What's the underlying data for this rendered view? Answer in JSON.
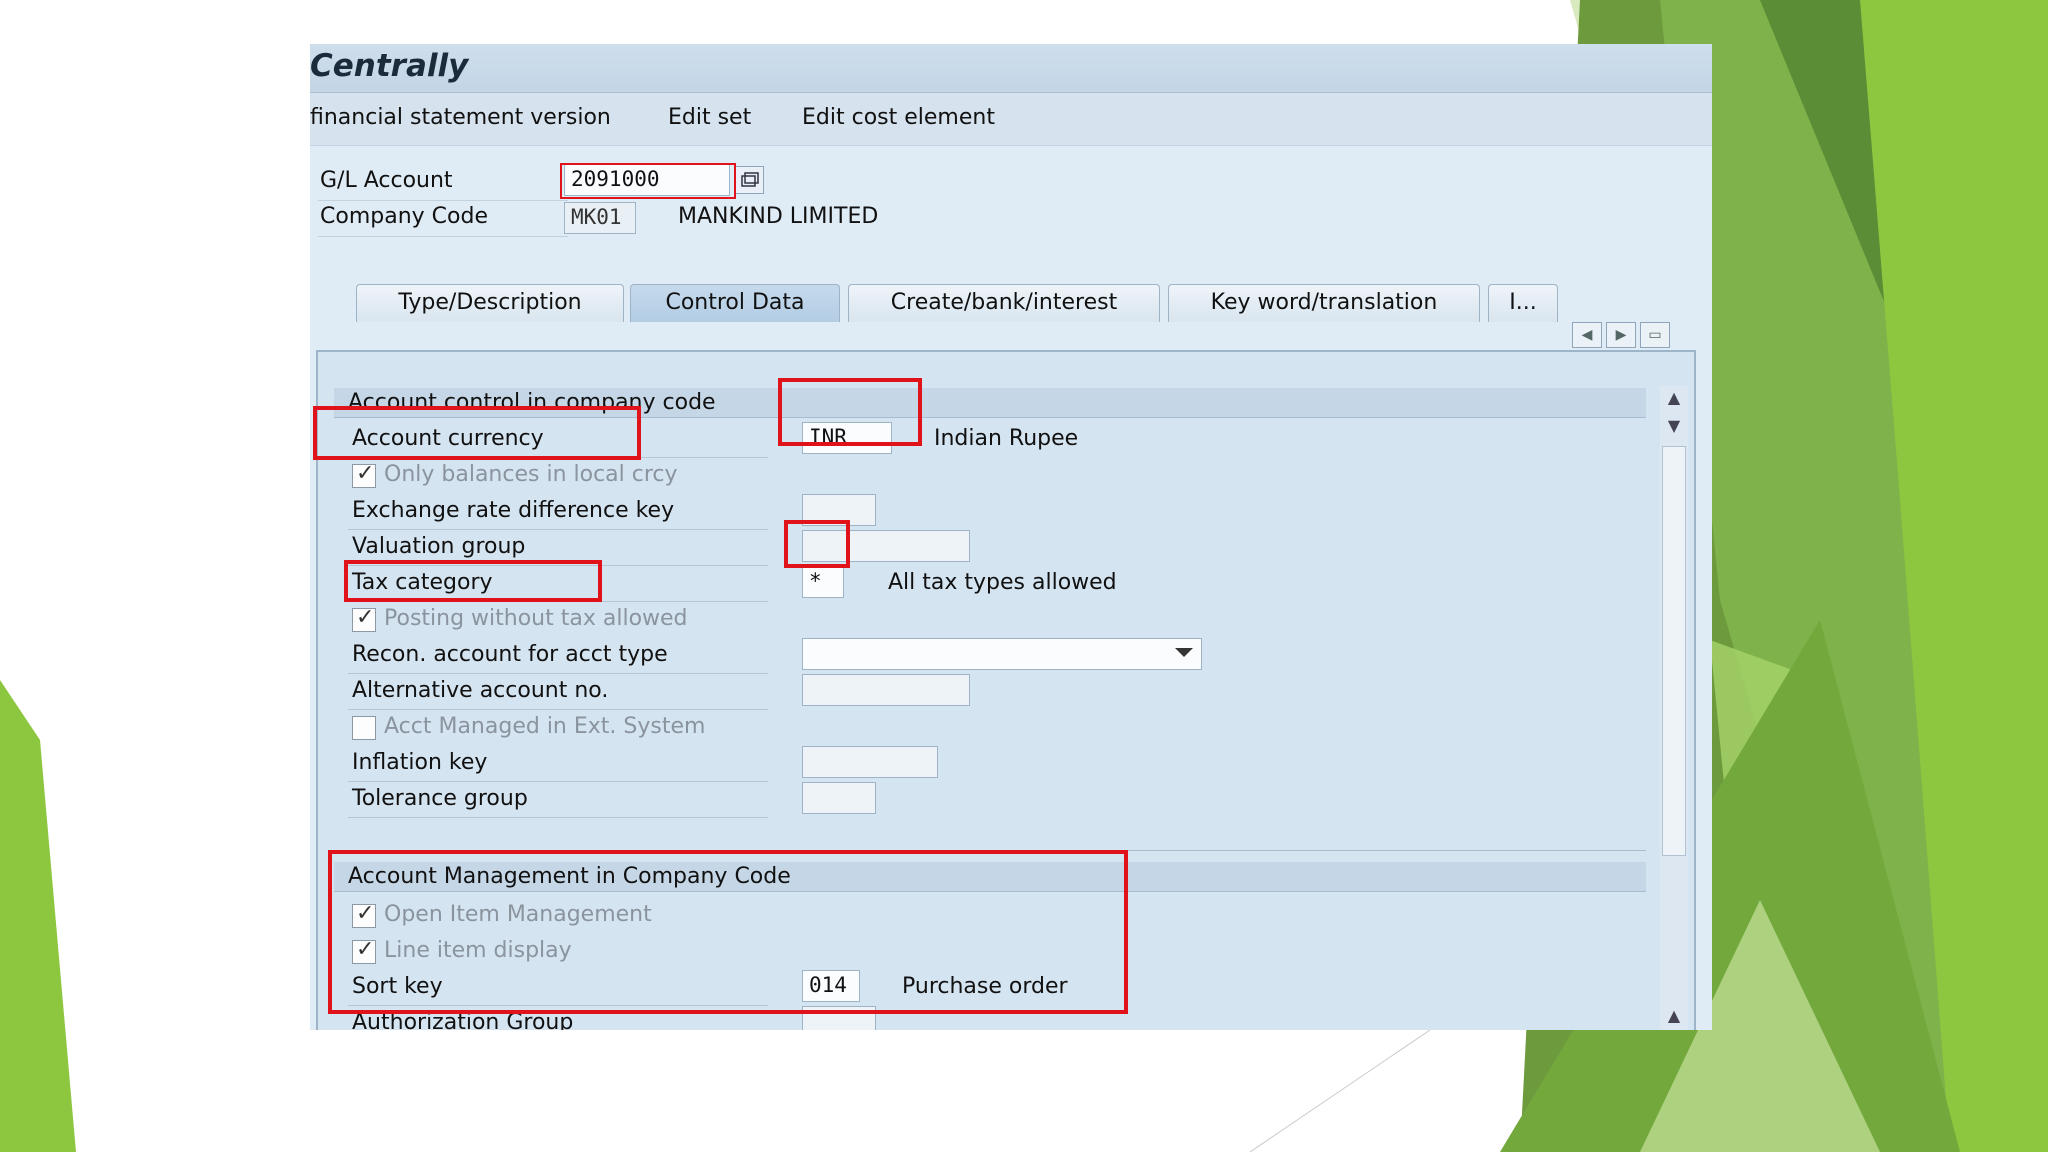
{
  "window": {
    "title": "Centrally"
  },
  "menu": {
    "items": [
      "financial statement version",
      "Edit set",
      "Edit cost element"
    ]
  },
  "header": {
    "gl_account_label": "G/L Account",
    "gl_account_value": "2091000",
    "company_code_label": "Company Code",
    "company_code_value": "MK01",
    "company_name": "MANKIND LIMITED"
  },
  "tabs": [
    "Type/Description",
    "Control Data",
    "Create/bank/interest",
    "Key word/translation",
    "I..."
  ],
  "active_tab": "Control Data",
  "section1": {
    "title": "Account control in company code",
    "account_currency_label": "Account currency",
    "account_currency_value": "INR",
    "account_currency_desc": "Indian Rupee",
    "only_balances_label": "Only balances in local crcy",
    "only_balances_checked": true,
    "exchange_rate_label": "Exchange rate difference key",
    "valuation_group_label": "Valuation group",
    "tax_category_label": "Tax category",
    "tax_category_value": "*",
    "tax_category_desc": "All tax types allowed",
    "posting_without_tax_label": "Posting without tax allowed",
    "posting_without_tax_checked": true,
    "recon_label": "Recon. account for acct type",
    "alt_account_label": "Alternative account no.",
    "acct_managed_label": "Acct Managed in Ext. System",
    "acct_managed_checked": false,
    "inflation_key_label": "Inflation key",
    "tolerance_group_label": "Tolerance group"
  },
  "section2": {
    "title": "Account Management in Company Code",
    "open_item_label": "Open Item Management",
    "open_item_checked": true,
    "line_item_label": "Line item display",
    "line_item_checked": true,
    "sort_key_label": "Sort key",
    "sort_key_value": "014",
    "sort_key_desc": "Purchase order",
    "auth_group_label": "Authorization Group"
  },
  "colors": {
    "highlight": "#e0131b",
    "accent_green": "#8dc63f"
  }
}
